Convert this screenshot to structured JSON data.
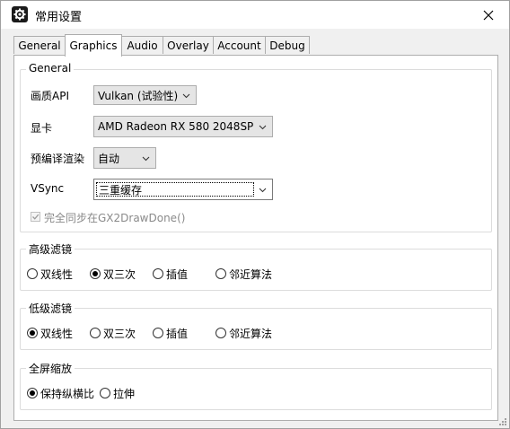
{
  "window": {
    "title": "常用设置"
  },
  "tabs": [
    {
      "label": "General"
    },
    {
      "label": "Graphics"
    },
    {
      "label": "Audio"
    },
    {
      "label": "Overlay"
    },
    {
      "label": "Account"
    },
    {
      "label": "Debug"
    }
  ],
  "active_tab": "Graphics",
  "general": {
    "title": "General",
    "api_label": "画质API",
    "api_value": "Vulkan (试验性)",
    "gpu_label": "显卡",
    "gpu_value": "AMD Radeon RX 580 2048SP",
    "precompile_label": "预编译渲染",
    "precompile_value": "自动",
    "vsync_label": "VSync",
    "vsync_value": "三重缓存",
    "fullsync_label": "完全同步在GX2DrawDone()",
    "fullsync_checked": true,
    "fullsync_disabled": true
  },
  "upscale": {
    "title": "高级滤镜",
    "options": [
      "双线性",
      "双三次",
      "插值",
      "邻近算法"
    ],
    "selected": "双三次"
  },
  "downscale": {
    "title": "低级滤镜",
    "options": [
      "双线性",
      "双三次",
      "插值",
      "邻近算法"
    ],
    "selected": "双线性"
  },
  "fullscreen_scaling": {
    "title": "全屏缩放",
    "options": [
      "保持纵横比",
      "拉伸"
    ],
    "selected": "保持纵横比"
  }
}
